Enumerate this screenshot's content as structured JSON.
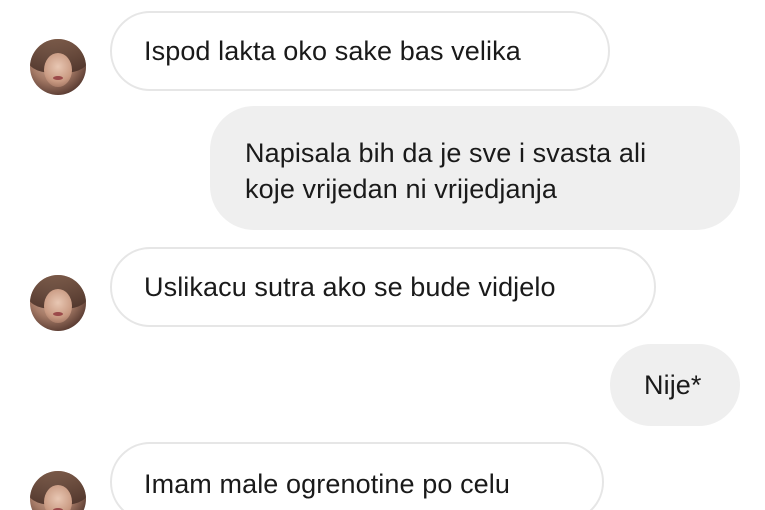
{
  "messages": [
    {
      "direction": "incoming",
      "text": "Ispod lakta oko sake bas velika",
      "avatar_icon": "contact-avatar"
    },
    {
      "direction": "outgoing",
      "lines": [
        "Napisala bih da je sve i svasta ali",
        "koje vrijedan ni vrijedjanja"
      ]
    },
    {
      "direction": "incoming",
      "text": "Uslikacu sutra ako se bude vidjelo",
      "avatar_icon": "contact-avatar"
    },
    {
      "direction": "outgoing",
      "text": "Nije*"
    },
    {
      "direction": "incoming",
      "text": "Imam male ogrenotine po celu",
      "avatar_icon": "contact-avatar"
    }
  ],
  "colors": {
    "incoming_bubble": "#ffffff",
    "incoming_border": "#e6e6e6",
    "outgoing_bubble": "#efefef",
    "text": "#1a1a1a"
  }
}
